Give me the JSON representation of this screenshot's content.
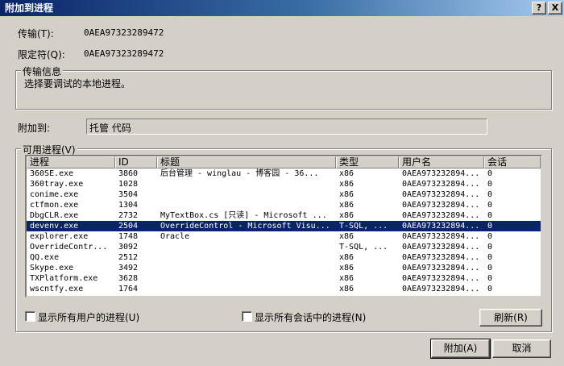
{
  "window": {
    "title": "附加到进程",
    "help_glyph": "?",
    "close_glyph": "X"
  },
  "transport": {
    "label": "传输(T):",
    "value": "0AEA97323289472"
  },
  "qualifier": {
    "label": "限定符(Q):",
    "value": "0AEA97323289472"
  },
  "transport_info": {
    "legend": "传输信息",
    "text": "选择要调试的本地进程。"
  },
  "attach_to": {
    "label": "附加到:",
    "value": "托管 代码"
  },
  "available": {
    "legend": "可用进程(V)",
    "columns": [
      "进程",
      "ID",
      "标题",
      "类型",
      "用户名",
      "会话"
    ],
    "rows": [
      [
        "360SE.exe",
        "3860",
        "后台管理 - winglau - 博客园 - 36...",
        "x86",
        "0AEA973232894...",
        "0"
      ],
      [
        "360tray.exe",
        "1028",
        "",
        "x86",
        "0AEA973232894...",
        "0"
      ],
      [
        "conime.exe",
        "3504",
        "",
        "x86",
        "0AEA973232894...",
        "0"
      ],
      [
        "ctfmon.exe",
        "1304",
        "",
        "x86",
        "0AEA973232894...",
        "0"
      ],
      [
        "DbgCLR.exe",
        "2732",
        "MyTextBox.cs [只读] - Microsoft ...",
        "x86",
        "0AEA973232894...",
        "0"
      ],
      [
        "devenv.exe",
        "2504",
        "OverrideControl - Microsoft Visu...",
        "T-SQL, ...",
        "0AEA973232894...",
        "0"
      ],
      [
        "explorer.exe",
        "1748",
        "Oracle",
        "x86",
        "0AEA973232894...",
        "0"
      ],
      [
        "OverrideContr...",
        "3092",
        "",
        "T-SQL, ...",
        "0AEA973232894...",
        "0"
      ],
      [
        "QQ.exe",
        "2512",
        "",
        "x86",
        "0AEA973232894...",
        "0"
      ],
      [
        "Skype.exe",
        "3492",
        "",
        "x86",
        "0AEA973232894...",
        "0"
      ],
      [
        "TXPlatform.exe",
        "3628",
        "",
        "x86",
        "0AEA973232894...",
        "0"
      ],
      [
        "wscntfy.exe",
        "1764",
        "",
        "x86",
        "0AEA973232894...",
        "0"
      ]
    ],
    "selected_index": 5
  },
  "options": {
    "all_users": "显示所有用户的进程(U)",
    "all_sessions": "显示所有会话中的进程(N)"
  },
  "buttons": {
    "refresh": "刷新(R)",
    "attach": "附加(A)",
    "cancel": "取消"
  }
}
